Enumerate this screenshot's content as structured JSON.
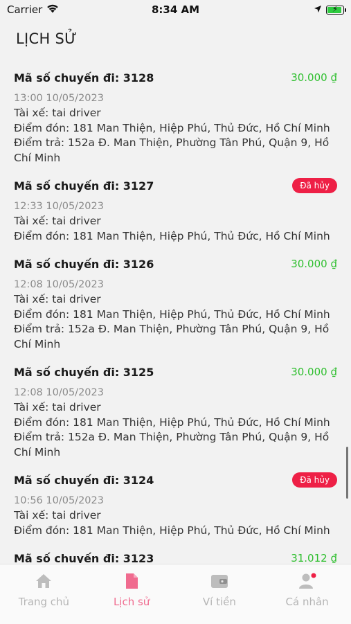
{
  "status_bar": {
    "carrier": "Carrier",
    "time": "8:34 AM"
  },
  "page": {
    "title": "LỊCH SỬ"
  },
  "trips": [
    {
      "title": "Mã số chuyến đi: 3128",
      "price": "30.000 ₫",
      "time": "13:00 10/05/2023",
      "driver": "Tài xế: tai driver",
      "pickup": "Điểm đón: 181 Man Thiện, Hiệp Phú, Thủ Đức, Hồ Chí Minh",
      "dropoff": "Điểm trả: 152a Đ. Man Thiện, Phường Tân Phú, Quận 9, Hồ Chí Minh"
    },
    {
      "title": "Mã số chuyến đi: 3127",
      "badge": "Đã hủy",
      "time": "12:33 10/05/2023",
      "driver": "Tài xế: tai driver",
      "pickup": "Điểm đón: 181 Man Thiện, Hiệp Phú, Thủ Đức, Hồ Chí Minh"
    },
    {
      "title": "Mã số chuyến đi: 3126",
      "price": "30.000 ₫",
      "time": "12:08 10/05/2023",
      "driver": "Tài xế: tai driver",
      "pickup": "Điểm đón: 181 Man Thiện, Hiệp Phú, Thủ Đức, Hồ Chí Minh",
      "dropoff": "Điểm trả: 152a Đ. Man Thiện, Phường Tân Phú, Quận 9, Hồ Chí Minh"
    },
    {
      "title": "Mã số chuyến đi: 3125",
      "price": "30.000 ₫",
      "time": "12:08 10/05/2023",
      "driver": "Tài xế: tai driver",
      "pickup": "Điểm đón: 181 Man Thiện, Hiệp Phú, Thủ Đức, Hồ Chí Minh",
      "dropoff": "Điểm trả: 152a Đ. Man Thiện, Phường Tân Phú, Quận 9, Hồ Chí Minh"
    },
    {
      "title": "Mã số chuyến đi: 3124",
      "badge": "Đã hủy",
      "time": "10:56 10/05/2023",
      "driver": "Tài xế: tai driver",
      "pickup": "Điểm đón: 181 Man Thiện, Hiệp Phú, Thủ Đức, Hồ Chí Minh"
    },
    {
      "title": "Mã số chuyến đi: 3123",
      "price": "31.012 ₫"
    }
  ],
  "tabs": [
    {
      "label": "Trang chủ",
      "icon": "home-icon"
    },
    {
      "label": "Lịch sử",
      "icon": "document-icon",
      "active": true
    },
    {
      "label": "Ví tiền",
      "icon": "wallet-icon"
    },
    {
      "label": "Cá nhân",
      "icon": "person-icon"
    }
  ],
  "colors": {
    "price_green": "#2fbf2f",
    "cancel_red": "#ee2046",
    "active_pink": "#f06b8f",
    "inactive_gray": "#b5b5b5"
  }
}
